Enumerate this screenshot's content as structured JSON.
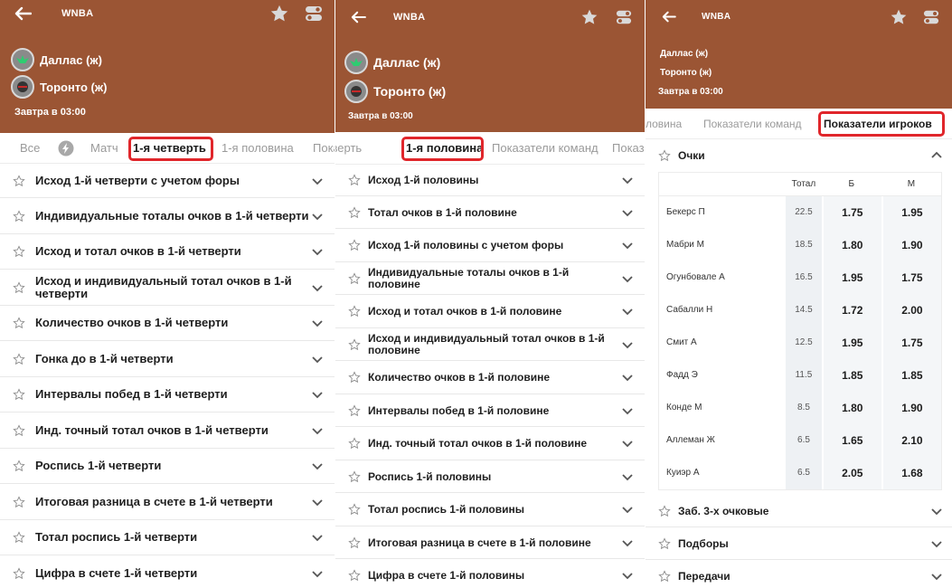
{
  "league": "WNBA",
  "teams": [
    "Даллас (ж)",
    "Торонто (ж)"
  ],
  "datetime": "Завтра в 03:00",
  "panel1": {
    "tabs": [
      "Все",
      "Матч",
      "1-я четверть",
      "1-я половина",
      "Показатели команд"
    ],
    "tab_partial": "Пока",
    "markets": [
      "Исход 1-й четверти с учетом форы",
      "Индивидуальные тоталы очков в 1-й четверти",
      "Исход и тотал очков в 1-й четверти",
      "Исход и индивидуальный тотал очков в 1-й четверти",
      "Количество очков в 1-й четверти",
      "Гонка до в 1-й четверти",
      "Интервалы побед в 1-й четверти",
      "Инд. точный тотал очков в 1-й четверти",
      "Роспись 1-й четверти",
      "Итоговая разница в счете в 1-й четверти",
      "Тотал роспись 1-й четверти",
      "Цифра в счете 1-й четверти"
    ]
  },
  "panel2": {
    "tab_left_partial": "четверть",
    "tab_active": "1-я половина",
    "tab_next": "Показатели команд",
    "tab_right_partial": "Показ",
    "markets": [
      "Исход 1-й половины",
      "Тотал очков в 1-й половине",
      "Исход 1-й половины с учетом форы",
      "Индивидуальные тоталы очков в 1-й половине",
      "Исход и тотал очков в 1-й половине",
      "Исход и индивидуальный тотал очков в 1-й половине",
      "Количество очков в 1-й половине",
      "Интервалы побед в 1-й половине",
      "Инд. точный тотал очков в 1-й половине",
      "Роспись 1-й половины",
      "Тотал роспись 1-й половины",
      "Итоговая разница в счете в 1-й половине",
      "Цифра в счете 1-й половины"
    ]
  },
  "panel3": {
    "tab_partial": "ловина",
    "tab_prev": "Показатели команд",
    "tab_active": "Показатели игроков",
    "section_title": "Очки",
    "columns": [
      "Тотал",
      "Б",
      "М"
    ],
    "players": [
      {
        "name": "Бекерс П",
        "total": "22.5",
        "over": "1.75",
        "under": "1.95"
      },
      {
        "name": "Мабри М",
        "total": "18.5",
        "over": "1.80",
        "under": "1.90"
      },
      {
        "name": "Огунбовале А",
        "total": "16.5",
        "over": "1.95",
        "under": "1.75"
      },
      {
        "name": "Сабалли Н",
        "total": "14.5",
        "over": "1.72",
        "under": "2.00"
      },
      {
        "name": "Смит А",
        "total": "12.5",
        "over": "1.95",
        "under": "1.75"
      },
      {
        "name": "Фадд Э",
        "total": "11.5",
        "over": "1.85",
        "under": "1.85"
      },
      {
        "name": "Конде М",
        "total": "8.5",
        "over": "1.80",
        "under": "1.90"
      },
      {
        "name": "Аллеман Ж",
        "total": "6.5",
        "over": "1.65",
        "under": "2.10"
      },
      {
        "name": "Куиэр А",
        "total": "6.5",
        "over": "2.05",
        "under": "1.68"
      }
    ],
    "collapsed_sections": [
      "Заб. 3-х очковые",
      "Подборы",
      "Передачи"
    ]
  },
  "colors": {
    "header": "#9b5534",
    "highlight": "#e0262b"
  }
}
